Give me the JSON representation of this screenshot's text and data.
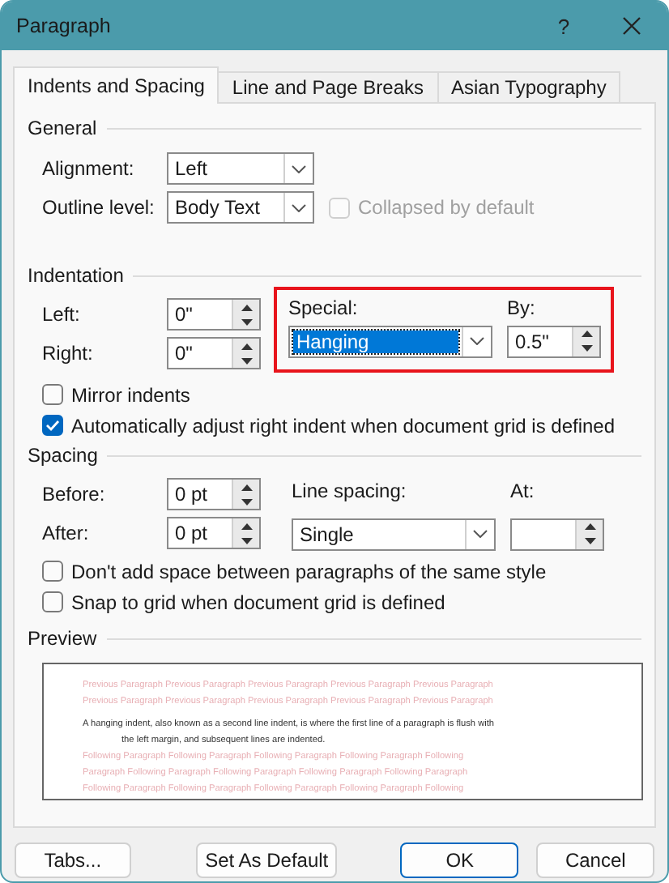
{
  "window": {
    "title": "Paragraph",
    "help": "?"
  },
  "tabs": [
    {
      "label": "Indents and Spacing",
      "selected": true
    },
    {
      "label": "Line and Page Breaks",
      "selected": false
    },
    {
      "label": "Asian Typography",
      "selected": false
    }
  ],
  "general": {
    "heading": "General",
    "alignment": {
      "label": "Alignment:",
      "value": "Left",
      "highlighted": false
    },
    "outline_level": {
      "label": "Outline level:",
      "value": "Body Text",
      "highlighted": false
    },
    "collapsed": {
      "label": "Collapsed by default",
      "checked": false,
      "disabled": true
    }
  },
  "indentation": {
    "heading": "Indentation",
    "left": {
      "label": "Left:",
      "value": "0\""
    },
    "right": {
      "label": "Right:",
      "value": "0\""
    },
    "special": {
      "label": "Special:",
      "value": "Hanging",
      "highlighted": true
    },
    "by": {
      "label": "By:",
      "value": "0.5\""
    },
    "checks": [
      {
        "label": "Mirror indents",
        "checked": false
      },
      {
        "label": "Automatically adjust right indent when document grid is defined",
        "checked": true
      }
    ]
  },
  "spacing": {
    "heading": "Spacing",
    "before": {
      "label": "Before:",
      "value": "0 pt"
    },
    "after": {
      "label": "After:",
      "value": "0 pt"
    },
    "line_spacing": {
      "label": "Line spacing:",
      "value": "Single",
      "highlighted": false
    },
    "at": {
      "label": "At:"
    },
    "checks": [
      {
        "label": "Don't add space between paragraphs of the same style",
        "checked": false
      },
      {
        "label": "Snap to grid when document grid is defined",
        "checked": false
      }
    ]
  },
  "preview": {
    "heading": "Preview",
    "lines": [
      {
        "kind": "context",
        "text": "Previous Paragraph Previous Paragraph Previous Paragraph Previous Paragraph Previous Paragraph"
      },
      {
        "kind": "context",
        "text": "Previous Paragraph Previous Paragraph Previous Paragraph Previous Paragraph Previous Paragraph"
      },
      {
        "kind": "sample",
        "text": "A hanging indent, also known as a second line indent, is where the first line of a paragraph is flush with"
      },
      {
        "kind": "sample-indented",
        "text": "the left margin, and subsequent lines are indented."
      },
      {
        "kind": "context",
        "text": "Following Paragraph Following Paragraph Following Paragraph Following Paragraph Following"
      },
      {
        "kind": "context",
        "text": "Paragraph Following Paragraph Following Paragraph Following Paragraph Following Paragraph"
      },
      {
        "kind": "context",
        "text": "Following Paragraph Following Paragraph Following Paragraph Following Paragraph Following"
      }
    ]
  },
  "buttons": [
    {
      "label": "Tabs...",
      "default": false
    },
    {
      "label": "Set As Default",
      "default": false
    },
    {
      "label": "OK",
      "default": true
    },
    {
      "label": "Cancel",
      "default": false
    }
  ]
}
